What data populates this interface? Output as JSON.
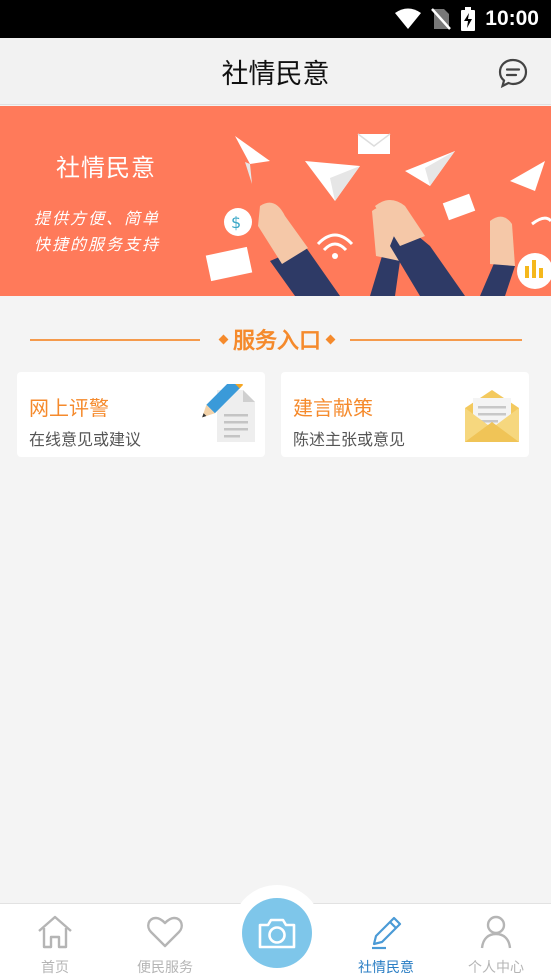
{
  "status_bar": {
    "time": "10:00",
    "icons": [
      "wifi-icon",
      "no-sim-icon",
      "battery-charging-icon"
    ]
  },
  "header": {
    "title": "社情民意",
    "action_icon": "message-icon"
  },
  "banner": {
    "title": "社情民意",
    "subtitle_line1": "提供方便、简单",
    "subtitle_line2": "快捷的服务支持",
    "background_color": "#ff7a5a"
  },
  "section": {
    "title": "服务入口",
    "accent_color": "#f58a2c"
  },
  "cards": [
    {
      "title": "网上评警",
      "description": "在线意见或建议",
      "icon": "pencil-document-icon"
    },
    {
      "title": "建言献策",
      "description": "陈述主张或意见",
      "icon": "envelope-icon"
    }
  ],
  "tab_bar": {
    "items": [
      {
        "label": "首页",
        "icon": "home-icon",
        "active": false
      },
      {
        "label": "便民服务",
        "icon": "heart-icon",
        "active": false
      },
      {
        "label": "",
        "icon": "camera-icon",
        "active": false
      },
      {
        "label": "社情民意",
        "icon": "pencil-icon",
        "active": true
      },
      {
        "label": "个人中心",
        "icon": "person-icon",
        "active": false
      }
    ],
    "active_color": "#2a7ec4",
    "camera_color": "#7ec6ea"
  }
}
